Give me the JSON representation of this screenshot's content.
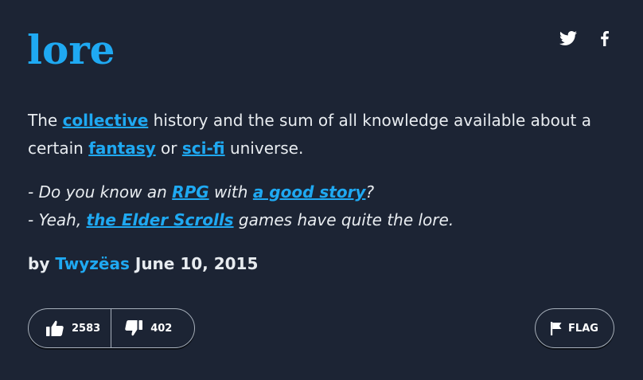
{
  "entry": {
    "word": "lore",
    "definition": {
      "t1": "The ",
      "link1": "collective",
      "t2": " history and the sum of all knowledge available about a certain ",
      "link2": "fantasy",
      "t3": " or ",
      "link3": "sci-fi",
      "t4": " universe."
    },
    "example": {
      "line1": {
        "t1": "- Do you know an ",
        "link1": "RPG",
        "t2": " with ",
        "link2": "a good story",
        "t3": "?"
      },
      "line2": {
        "t1": "- Yeah, ",
        "link1": "the Elder Scrolls",
        "t2": " games have quite the lore."
      }
    },
    "author": {
      "prefix": "by ",
      "name": "Twyzëas",
      "date": "June 10, 2015"
    },
    "votes": {
      "up": "2583",
      "down": "402"
    },
    "flag_label": "FLAG"
  },
  "share": {
    "icons": [
      "twitter-icon",
      "facebook-icon"
    ]
  },
  "colors": {
    "background": "#1c2434",
    "accent": "#1fa9f2",
    "text": "#e8ecf0",
    "border": "#a7b0bb"
  }
}
